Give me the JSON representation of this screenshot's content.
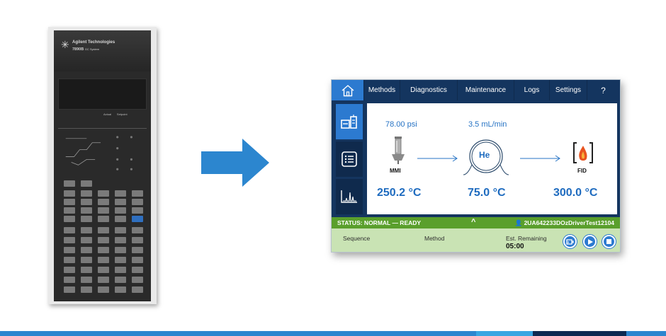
{
  "legacy_instrument": {
    "brand": "Agilent Technologies",
    "model": "7890B",
    "model_suffix": "GC System",
    "display_label_actual": "Actual",
    "display_label_setpoint": "Setpoint"
  },
  "arrow": {
    "icon": "right-arrow-icon",
    "color": "#2c86cf"
  },
  "ui": {
    "nav": {
      "home_icon": "home-icon",
      "methods": "Methods",
      "diagnostics": "Diagnostics",
      "maintenance": "Maintenance",
      "logs": "Logs",
      "settings": "Settings",
      "help": "?"
    },
    "sidebar": [
      {
        "icon": "instrument-icon",
        "active": true
      },
      {
        "icon": "list-icon",
        "active": false
      },
      {
        "icon": "chromatogram-icon",
        "active": false
      }
    ],
    "flow": {
      "pressure": "78.00 psi",
      "flow_rate": "3.5 mL/min",
      "inlet_label": "MMI",
      "column_gas": "He",
      "detector_label": "FID",
      "inlet_temp": "250.2 °C",
      "oven_temp": "75.0 °C",
      "detector_temp": "300.0 °C"
    },
    "status": {
      "text": "STATUS: NORMAL — READY",
      "chevron": "^",
      "user": "2UA642233DOzDriverTest12104"
    },
    "info": {
      "sequence_label": "Sequence",
      "method_label": "Method",
      "remaining_label": "Est. Remaining",
      "remaining_value": "05:00"
    },
    "controls": [
      "prep-run-icon",
      "play-icon",
      "stop-icon"
    ],
    "colors": {
      "navy": "#14355f",
      "accent_blue": "#2c7ad0",
      "status_green": "#5a9f2c",
      "info_green": "#c9e3b4"
    }
  }
}
